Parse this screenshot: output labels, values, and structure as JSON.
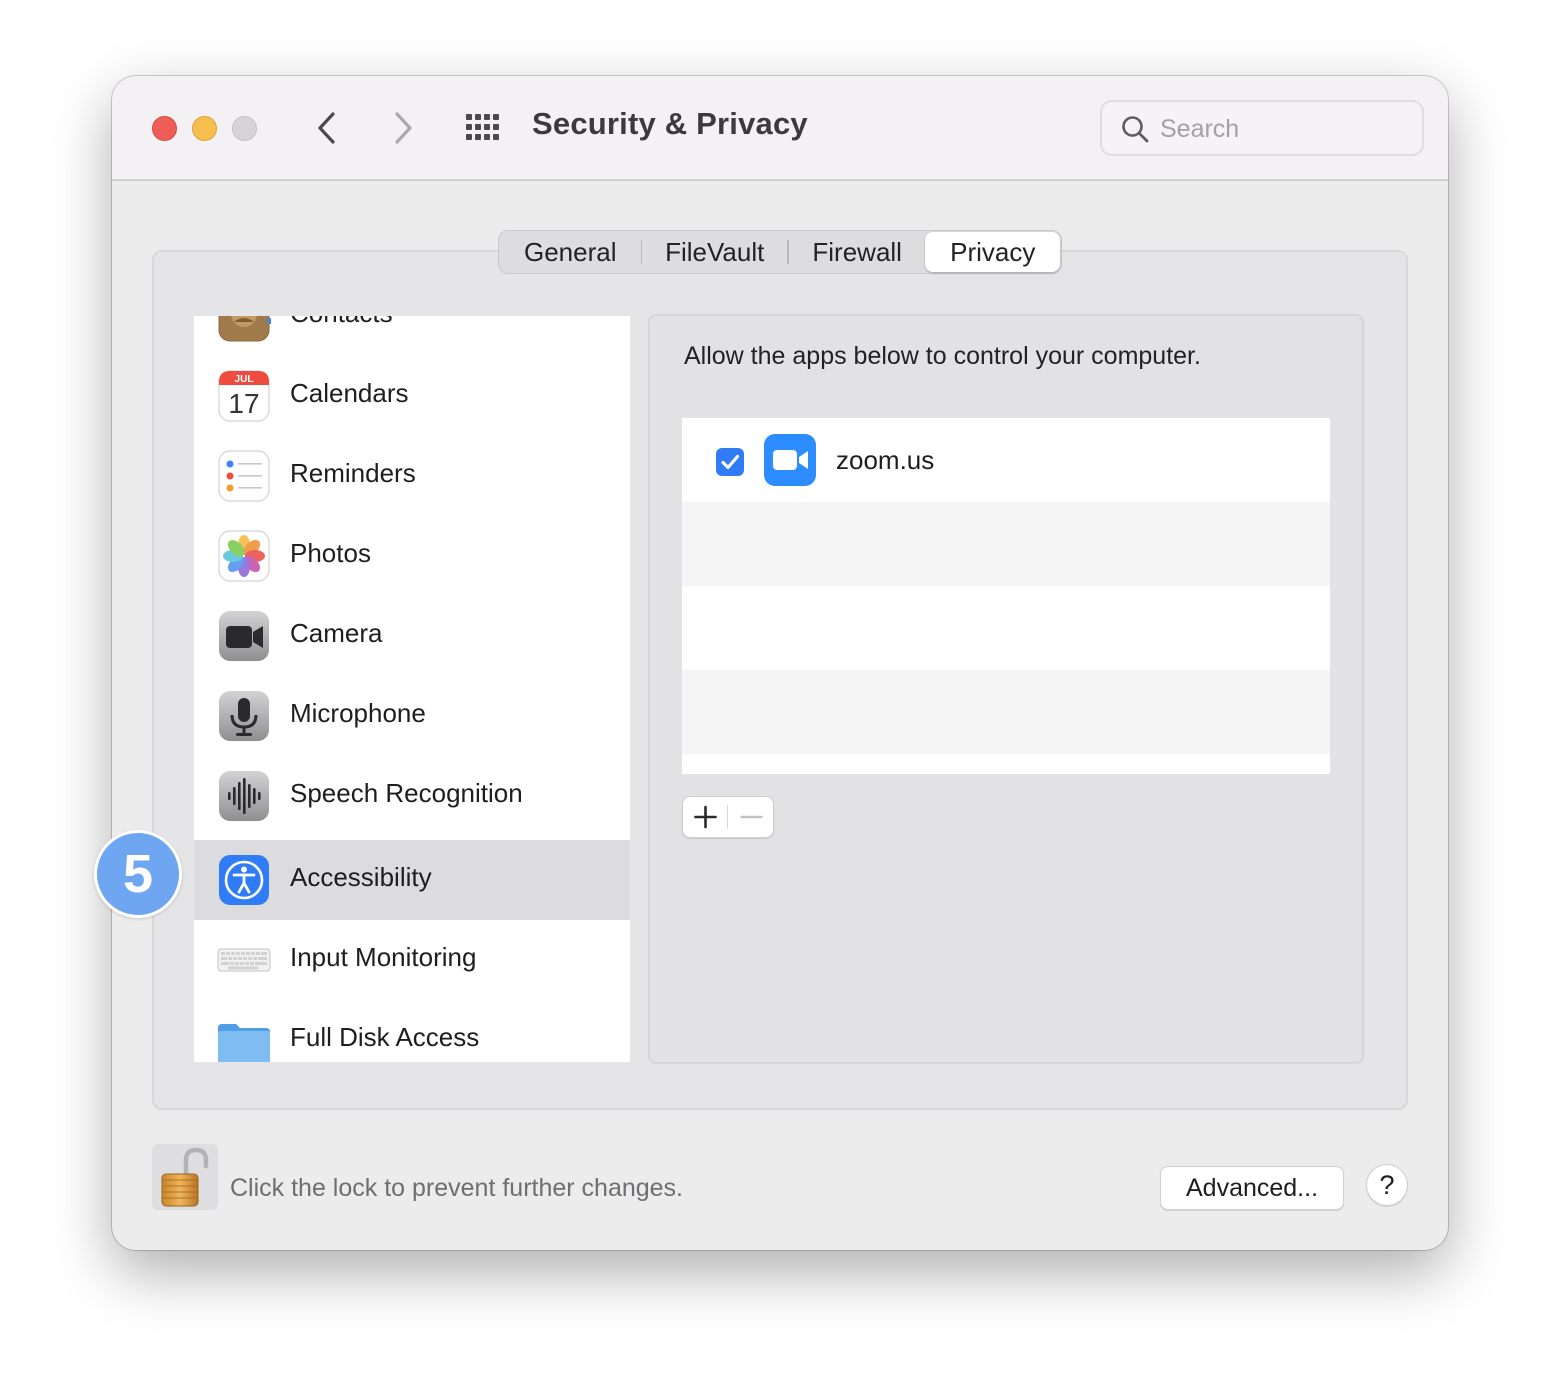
{
  "window": {
    "title": "Security & Privacy",
    "search_placeholder": "Search"
  },
  "tabs": [
    "General",
    "FileVault",
    "Firewall",
    "Privacy"
  ],
  "selected_tab": "Privacy",
  "sidebar": {
    "items": [
      {
        "label": "Contacts",
        "icon": "contacts-icon"
      },
      {
        "label": "Calendars",
        "icon": "calendar-icon",
        "icon_month": "JUL",
        "icon_day": "17"
      },
      {
        "label": "Reminders",
        "icon": "reminders-icon"
      },
      {
        "label": "Photos",
        "icon": "photos-icon"
      },
      {
        "label": "Camera",
        "icon": "camera-icon"
      },
      {
        "label": "Microphone",
        "icon": "microphone-icon"
      },
      {
        "label": "Speech Recognition",
        "icon": "speech-recognition-icon"
      },
      {
        "label": "Accessibility",
        "icon": "accessibility-icon"
      },
      {
        "label": "Input Monitoring",
        "icon": "keyboard-icon"
      },
      {
        "label": "Full Disk Access",
        "icon": "folder-icon"
      }
    ],
    "selected": "Accessibility"
  },
  "panel": {
    "description": "Allow the apps below to control your computer.",
    "apps": [
      {
        "name": "zoom.us",
        "checked": true,
        "icon": "zoom-icon"
      }
    ],
    "add_label": "+",
    "remove_label": "−"
  },
  "footer": {
    "lock_text": "Click the lock to prevent further changes.",
    "advanced_label": "Advanced...",
    "help_label": "?"
  },
  "annotation": {
    "step_number": "5"
  },
  "colors": {
    "accent": "#2f7cf6",
    "close": "#ee5e56",
    "minimize": "#f5be4f",
    "zoom_disabled": "#d6d3d6",
    "step_badge": "#6fa6f1",
    "selected_row": "#dcdbdd"
  }
}
